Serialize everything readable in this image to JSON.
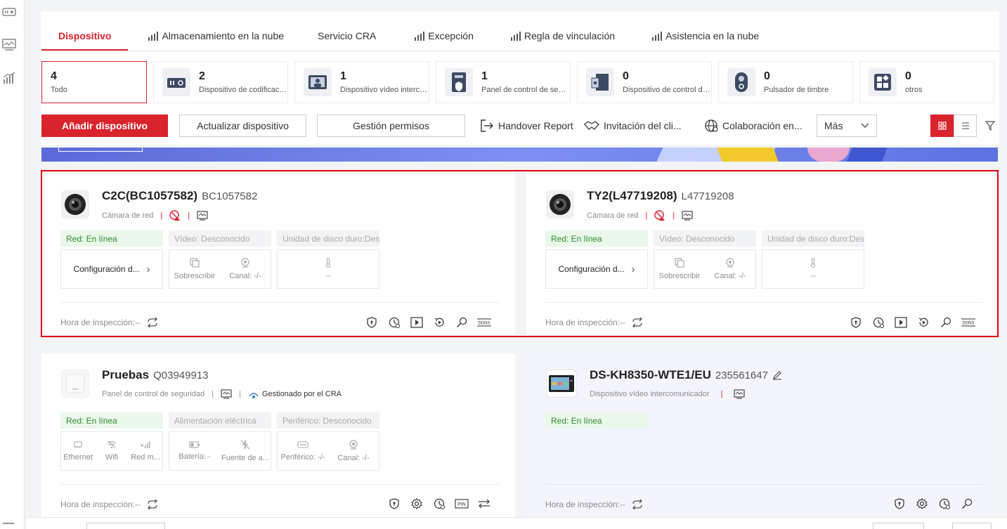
{
  "tabs": [
    {
      "label": "Dispositivo",
      "active": true,
      "icon": ""
    },
    {
      "label": "Almacenamiento en la nube",
      "active": false,
      "icon": "bar-chart-icon"
    },
    {
      "label": "Servicio CRA",
      "active": false,
      "icon": ""
    },
    {
      "label": "Excepción",
      "active": false,
      "icon": "bar-chart-icon"
    },
    {
      "label": "Regla de vinculación",
      "active": false,
      "icon": "bar-chart-icon"
    },
    {
      "label": "Asistencia en la nube",
      "active": false,
      "icon": "bar-chart-icon"
    }
  ],
  "categories": [
    {
      "count": "4",
      "label": "Todo",
      "active": true
    },
    {
      "count": "2",
      "label": "Dispositivo de codificación",
      "icon": "encoder-icon"
    },
    {
      "count": "1",
      "label": "Dispositivo vídeo intercomunicador",
      "icon": "intercom-icon"
    },
    {
      "count": "1",
      "label": "Panel de control de seguridad",
      "icon": "security-panel-icon"
    },
    {
      "count": "0",
      "label": "Dispositivo de control de acceso",
      "icon": "access-control-icon"
    },
    {
      "count": "0",
      "label": "Pulsador de timbre",
      "icon": "doorbell-icon"
    },
    {
      "count": "0",
      "label": "otros",
      "icon": "others-icon"
    }
  ],
  "toolbar": {
    "add": "Añadir dispositivo",
    "update": "Actualizar dispositivo",
    "permissions": "Gestión permisos",
    "handover": "Handover Report",
    "invite": "Invitación del cli...",
    "collab": "Colaboración en...",
    "more": "Más"
  },
  "cards": [
    {
      "name": "C2C(BC1057582)",
      "serial": "BC1057582",
      "type": "Cámara de red",
      "status": "Red: En línea",
      "chip2": "Vídeo: Desconocido",
      "chip3": "Unidad de disco duro:Desconocido",
      "config": "Configuración d...",
      "cell1": "Sobrescribir",
      "cell2": "Canal: -/-",
      "cell3": "--",
      "inspection": "Hora de inspección:--"
    },
    {
      "name": "TY2(L47719208)",
      "serial": "L47719208",
      "type": "Cámara de red",
      "status": "Red: En línea",
      "chip2": "Vídeo: Desconocido",
      "chip3": "Unidad de disco duro:Desconocido",
      "config": "Configuración d...",
      "cell1": "Sobrescribir",
      "cell2": "Canal: -/-",
      "cell3": "--",
      "inspection": "Hora de inspección:--"
    },
    {
      "name": "Pruebas",
      "serial": "Q03949913",
      "type": "Panel de control de seguridad",
      "cra": "Gestionado por el CRA",
      "status": "Red: En línea",
      "chip2": "Alimentación eléctrica",
      "chip3": "Periférico: Desconocido",
      "b1": [
        "Ethernet",
        "Wifi",
        "Red m..."
      ],
      "b2": [
        "Batería: -",
        "Fuente de a..."
      ],
      "b3": [
        "Periférico: -/-",
        "Canal: -/-"
      ],
      "inspection": "Hora de inspección:--"
    },
    {
      "name": "DS-KH8350-WTE1/EU",
      "serial": "235561647",
      "type": "Dispositivo vídeo intercomunicador",
      "status": "Red: En línea",
      "inspection": "Hora de inspección:--"
    }
  ]
}
